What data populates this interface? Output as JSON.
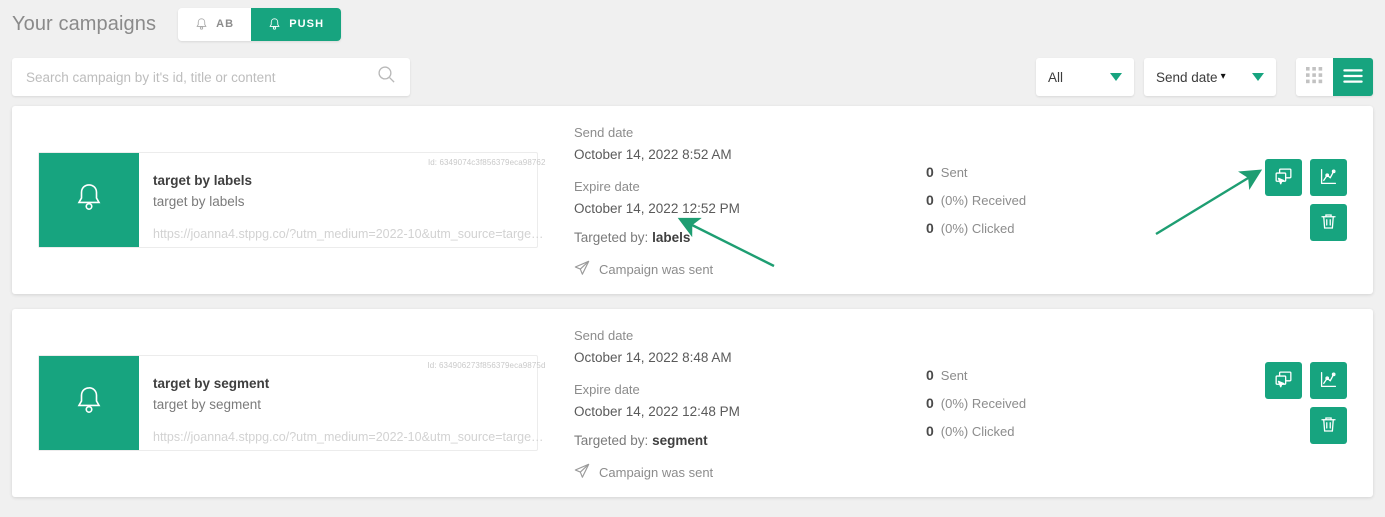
{
  "header": {
    "title": "Your campaigns",
    "type_tabs": [
      {
        "label": "AB",
        "icon": "bell-icon",
        "active": false
      },
      {
        "label": "PUSH",
        "icon": "bell-icon",
        "active": true
      }
    ]
  },
  "filters": {
    "search_placeholder": "Search campaign by it's id, title or content",
    "search_value": "",
    "search_icon": "search-icon",
    "status_filter": {
      "value": "All",
      "options": [
        "All"
      ]
    },
    "sort_filter": {
      "value": "Send date",
      "caret": "▾",
      "options": [
        "Send date"
      ]
    },
    "view_modes": [
      {
        "name": "grid-view",
        "icon": "grid-icon",
        "active": false
      },
      {
        "name": "list-view",
        "icon": "list-icon",
        "active": true
      }
    ]
  },
  "accent_color": "#17a47f",
  "labels": {
    "send_date": "Send date",
    "expire_date": "Expire date",
    "targeted_by": "Targeted by:",
    "status_sent": "Campaign was sent",
    "sent": "Sent",
    "received": "Received",
    "clicked": "Clicked",
    "id_prefix": "Id:"
  },
  "campaigns": [
    {
      "id": "Id: 6349074c3f856379eca98762",
      "title": "target by labels",
      "subtitle": "target by labels",
      "url": "https://joanna4.stppg.co/?utm_medium=2022-10&utm_source=targe…",
      "thumb_icon": "bell-icon",
      "send_date_label": "Send date",
      "send_date": "October 14, 2022 8:52 AM",
      "expire_date_label": "Expire date",
      "expire_date": "October 14, 2022 12:52 PM",
      "targeted_by_label": "Targeted by:",
      "targeted_by_value": "labels",
      "status": "Campaign was sent",
      "stats": [
        {
          "num": "0",
          "text": "Sent"
        },
        {
          "num": "0",
          "text": "(0%) Received"
        },
        {
          "num": "0",
          "text": "(0%) Clicked"
        }
      ],
      "actions": [
        {
          "name": "duplicate-button",
          "icon": "duplicate-icon"
        },
        {
          "name": "statistics-button",
          "icon": "chart-icon"
        },
        {
          "name": "delete-button",
          "icon": "trash-icon"
        }
      ]
    },
    {
      "id": "Id: 634906273f856379eca9875d",
      "title": "target by segment",
      "subtitle": "target by segment",
      "url": "https://joanna4.stppg.co/?utm_medium=2022-10&utm_source=targe…",
      "thumb_icon": "bell-icon",
      "send_date_label": "Send date",
      "send_date": "October 14, 2022 8:48 AM",
      "expire_date_label": "Expire date",
      "expire_date": "October 14, 2022 12:48 PM",
      "targeted_by_label": "Targeted by:",
      "targeted_by_value": "segment",
      "status": "Campaign was sent",
      "stats": [
        {
          "num": "0",
          "text": "Sent"
        },
        {
          "num": "0",
          "text": "(0%) Received"
        },
        {
          "num": "0",
          "text": "(0%) Clicked"
        }
      ],
      "actions": [
        {
          "name": "duplicate-button",
          "icon": "duplicate-icon"
        },
        {
          "name": "statistics-button",
          "icon": "chart-icon"
        },
        {
          "name": "delete-button",
          "icon": "trash-icon"
        }
      ]
    }
  ],
  "annotations": [
    {
      "name": "arrow-to-targeted-by",
      "color": "#1e9e72"
    },
    {
      "name": "arrow-to-action-buttons",
      "color": "#1e9e72"
    }
  ]
}
